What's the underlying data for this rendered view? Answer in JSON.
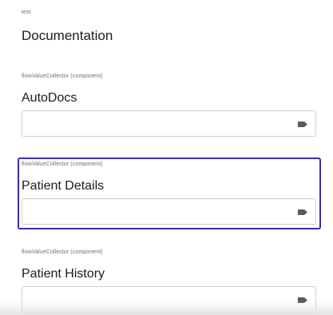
{
  "text_block": {
    "type_label": "text",
    "title": "Documentation"
  },
  "collectors": [
    {
      "type_label": "flowValueCollector (component)",
      "title": "AutoDocs",
      "value": "",
      "icon": "tag-icon"
    },
    {
      "type_label": "flowValueCollector (component)",
      "title": "Patient Details",
      "value": "",
      "icon": "tag-icon",
      "selected": true
    },
    {
      "type_label": "flowValueCollector (component)",
      "title": "Patient History",
      "value": "",
      "icon": "tag-icon"
    }
  ],
  "colors": {
    "selection_border": "#3d2bb0",
    "field_border": "#cfcfcf",
    "icon": "#5a5a5a"
  }
}
